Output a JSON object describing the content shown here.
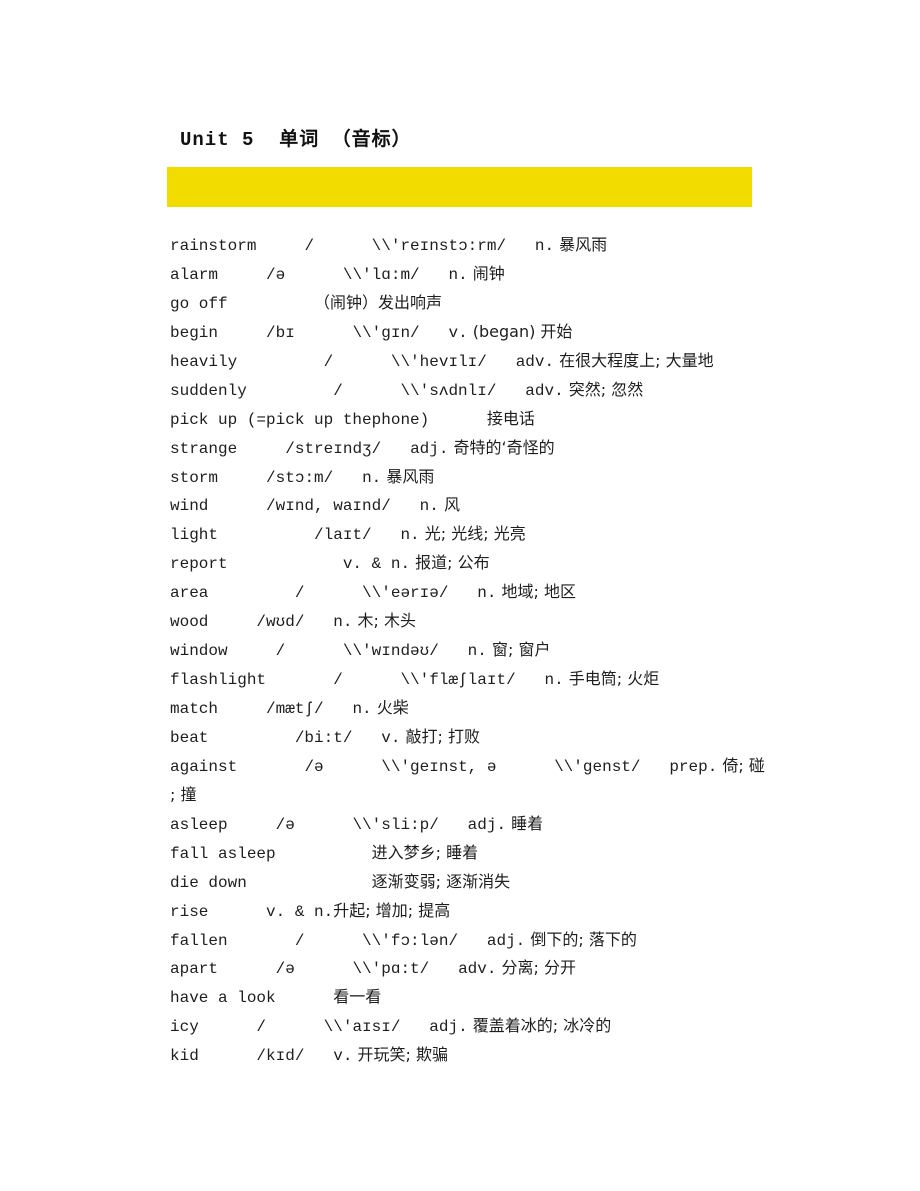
{
  "document": {
    "title": "Unit 5  单词 （音标）",
    "highlight_color": "#f2dc00"
  },
  "entries": [
    {
      "word": "rainstorm",
      "gap1": "     ",
      "phonetic": "/      \\\\'reɪnstɔ:rm/",
      "gap2": "   ",
      "pos": "n.",
      "meaning": " 暴风雨"
    },
    {
      "word": "alarm",
      "gap1": "     ",
      "phonetic": "/ə      \\\\'lɑ:m/",
      "gap2": "   ",
      "pos": "n.",
      "meaning": " 闹钟"
    },
    {
      "word": "go off",
      "gap1": "         ",
      "phonetic": "",
      "gap2": "",
      "pos": "",
      "meaning": "（闹钟）发出响声"
    },
    {
      "word": "begin",
      "gap1": "     ",
      "phonetic": "/bɪ      \\\\'gɪn/",
      "gap2": "   ",
      "pos": "v.",
      "meaning": " (began) 开始"
    },
    {
      "word": "heavily",
      "gap1": "         ",
      "phonetic": "/      \\\\'hevɪlɪ/",
      "gap2": "   ",
      "pos": "adv.",
      "meaning": " 在很大程度上; 大量地"
    },
    {
      "word": "suddenly",
      "gap1": "         ",
      "phonetic": "/      \\\\'sʌdnlɪ/",
      "gap2": "   ",
      "pos": "adv.",
      "meaning": " 突然; 忽然"
    },
    {
      "word": "pick up (=pick up thephone)",
      "gap1": "      ",
      "phonetic": "",
      "gap2": "",
      "pos": "",
      "meaning": "接电话"
    },
    {
      "word": "strange",
      "gap1": "     ",
      "phonetic": "/streɪndʒ/",
      "gap2": "   ",
      "pos": "adj.",
      "meaning": " 奇特的‘奇怪的"
    },
    {
      "word": "storm",
      "gap1": "     ",
      "phonetic": "/stɔ:m/",
      "gap2": "   ",
      "pos": "n.",
      "meaning": " 暴风雨"
    },
    {
      "word": "wind",
      "gap1": "      ",
      "phonetic": "/wɪnd, waɪnd/",
      "gap2": "   ",
      "pos": "n.",
      "meaning": " 风"
    },
    {
      "word": "light",
      "gap1": "          ",
      "phonetic": "/laɪt/",
      "gap2": "   ",
      "pos": "n.",
      "meaning": " 光; 光线; 光亮"
    },
    {
      "word": "report",
      "gap1": "            ",
      "phonetic": "",
      "gap2": "",
      "pos": "v. & n.",
      "meaning": " 报道; 公布"
    },
    {
      "word": "area",
      "gap1": "         ",
      "phonetic": "/      \\\\'eərɪə/",
      "gap2": "   ",
      "pos": "n.",
      "meaning": " 地域; 地区"
    },
    {
      "word": "wood",
      "gap1": "     ",
      "phonetic": "/wʊd/",
      "gap2": "   ",
      "pos": "n.",
      "meaning": " 木; 木头"
    },
    {
      "word": "window",
      "gap1": "     ",
      "phonetic": "/      \\\\'wɪndəʊ/",
      "gap2": "   ",
      "pos": "n.",
      "meaning": " 窗; 窗户"
    },
    {
      "word": "flashlight",
      "gap1": "       ",
      "phonetic": "/      \\\\'flæʃlaɪt/",
      "gap2": "   ",
      "pos": "n.",
      "meaning": " 手电筒; 火炬"
    },
    {
      "word": "match",
      "gap1": "     ",
      "phonetic": "/mætʃ/",
      "gap2": "   ",
      "pos": "n.",
      "meaning": " 火柴"
    },
    {
      "word": "beat",
      "gap1": "         ",
      "phonetic": "/bi:t/",
      "gap2": "   ",
      "pos": "v.",
      "meaning": " 敲打; 打败"
    },
    {
      "word": "against",
      "gap1": "       ",
      "phonetic": "/ə      \\\\'geɪnst, ə      \\\\'genst/",
      "gap2": "   ",
      "pos": "prep.",
      "meaning": " 倚; 碰"
    },
    {
      "word": "",
      "gap1": "",
      "phonetic": "",
      "gap2": "",
      "pos": "",
      "meaning": "; 撞"
    },
    {
      "word": "asleep",
      "gap1": "     ",
      "phonetic": "/ə      \\\\'sli:p/",
      "gap2": "   ",
      "pos": "adj.",
      "meaning": " 睡着"
    },
    {
      "word": "fall asleep",
      "gap1": "          ",
      "phonetic": "",
      "gap2": "",
      "pos": "",
      "meaning": "进入梦乡; 睡着"
    },
    {
      "word": "die down",
      "gap1": "             ",
      "phonetic": "",
      "gap2": "",
      "pos": "",
      "meaning": "逐渐变弱; 逐渐消失"
    },
    {
      "word": "rise",
      "gap1": "      ",
      "phonetic": "",
      "gap2": "",
      "pos": "v. & n.",
      "meaning": "升起; 增加; 提高"
    },
    {
      "word": "fallen",
      "gap1": "       ",
      "phonetic": "/      \\\\'fɔ:lən/",
      "gap2": "   ",
      "pos": "adj.",
      "meaning": " 倒下的; 落下的"
    },
    {
      "word": "apart",
      "gap1": "      ",
      "phonetic": "/ə      \\\\'pɑ:t/",
      "gap2": "   ",
      "pos": "adv.",
      "meaning": " 分离; 分开"
    },
    {
      "word": "have a look",
      "gap1": "      ",
      "phonetic": "",
      "gap2": "",
      "pos": "",
      "meaning": "看一看"
    },
    {
      "word": "icy",
      "gap1": "      ",
      "phonetic": "/      \\\\'aɪsɪ/",
      "gap2": "   ",
      "pos": "adj.",
      "meaning": " 覆盖着冰的; 冰冷的"
    },
    {
      "word": "kid",
      "gap1": "      ",
      "phonetic": "/kɪd/",
      "gap2": "   ",
      "pos": "v.",
      "meaning": " 开玩笑; 欺骗"
    }
  ]
}
